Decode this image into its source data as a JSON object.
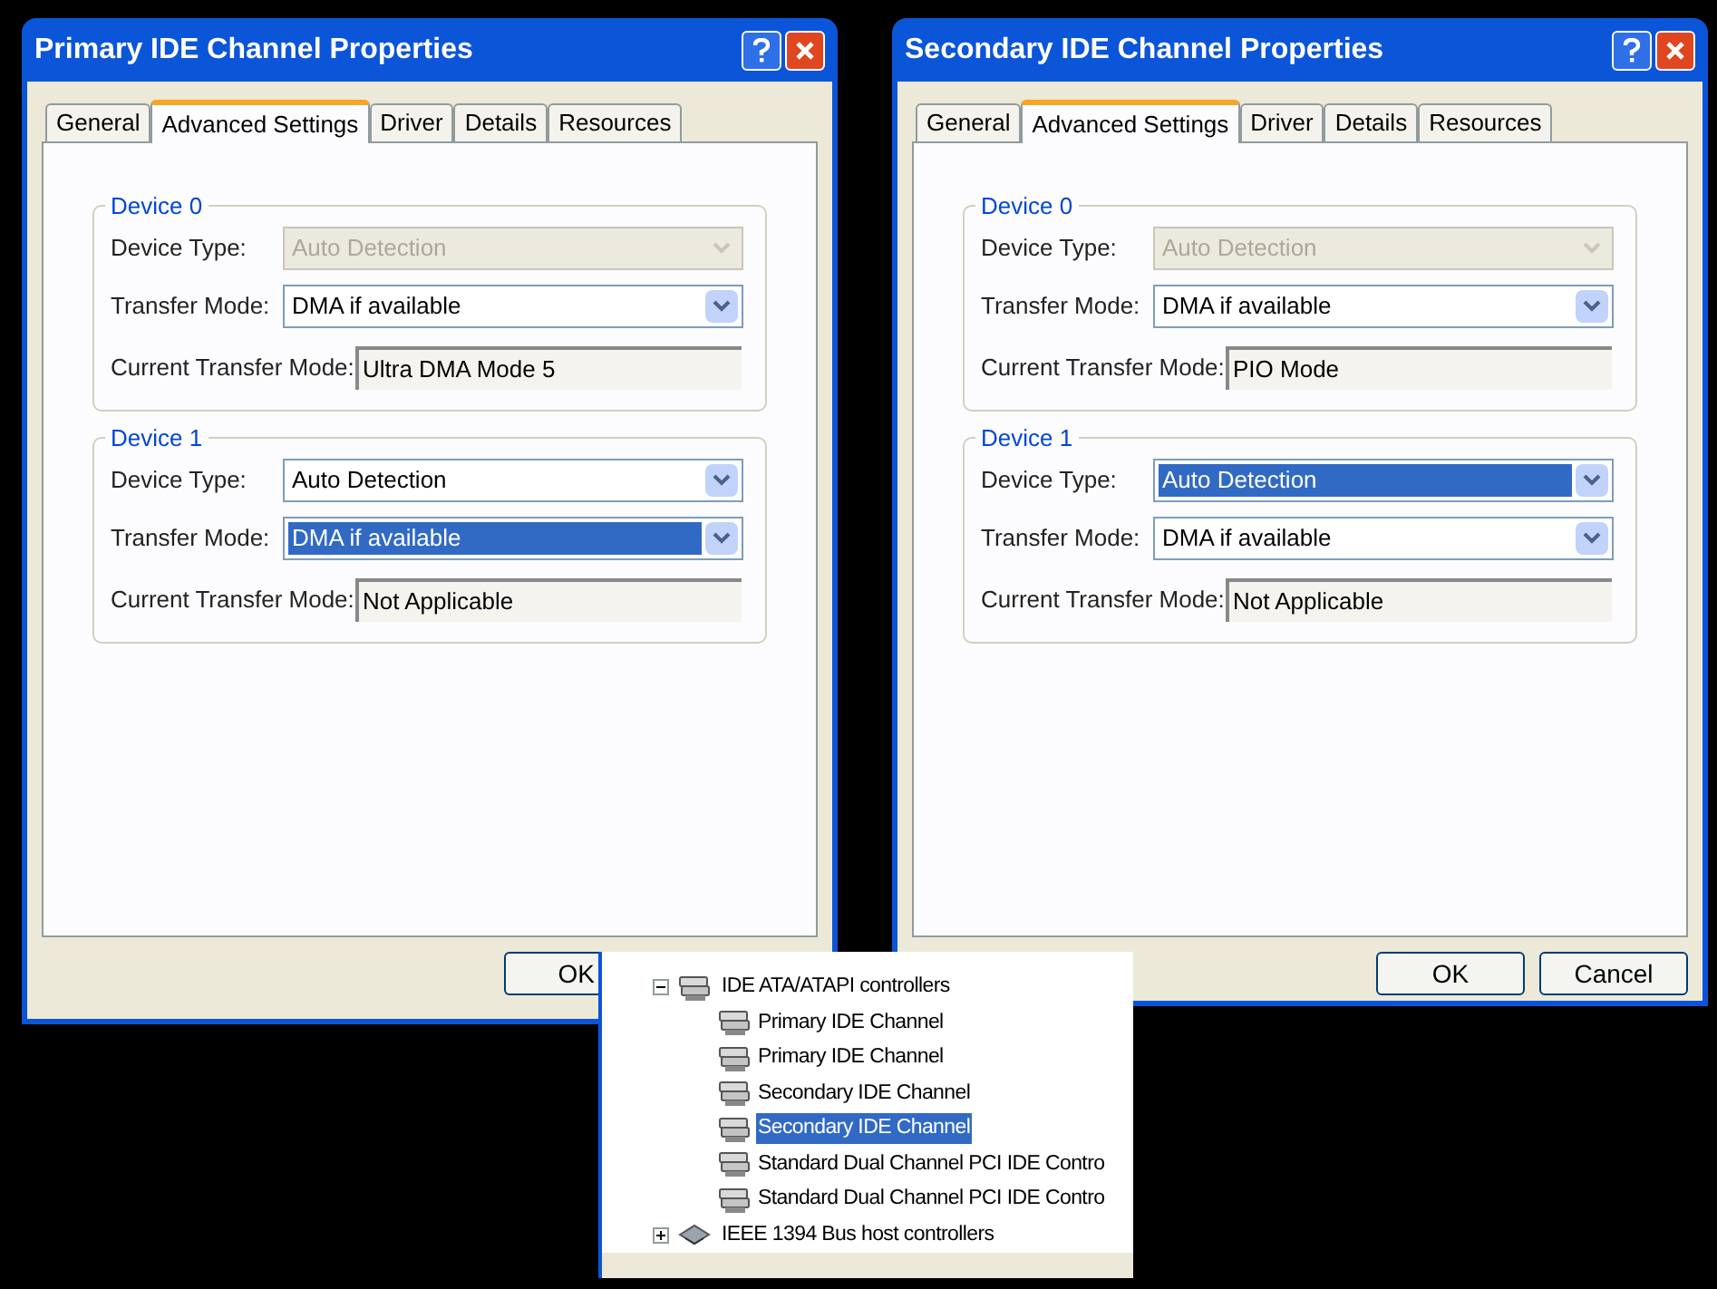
{
  "dialogs": [
    {
      "title": "Primary IDE Channel Properties",
      "tabs": [
        {
          "label": "General",
          "selected": false
        },
        {
          "label": "Advanced Settings",
          "selected": true
        },
        {
          "label": "Driver",
          "selected": false
        },
        {
          "label": "Details",
          "selected": false
        },
        {
          "label": "Resources",
          "selected": false
        }
      ],
      "groups": [
        {
          "title": "Device 0",
          "fields": [
            {
              "kind": "select",
              "label": "Device Type:",
              "value": "Auto Detection",
              "disabled": true,
              "selected": false
            },
            {
              "kind": "select",
              "label": "Transfer Mode:",
              "value": "DMA if available",
              "disabled": false,
              "selected": false
            },
            {
              "kind": "readonly",
              "label": "Current Transfer Mode:",
              "value": "Ultra DMA Mode 5"
            }
          ]
        },
        {
          "title": "Device 1",
          "fields": [
            {
              "kind": "select",
              "label": "Device Type:",
              "value": "Auto Detection",
              "disabled": false,
              "selected": false
            },
            {
              "kind": "select",
              "label": "Transfer Mode:",
              "value": "DMA if available",
              "disabled": false,
              "selected": true
            },
            {
              "kind": "readonly",
              "label": "Current Transfer Mode:",
              "value": "Not Applicable"
            }
          ]
        }
      ],
      "buttons": [
        "OK"
      ]
    },
    {
      "title": "Secondary IDE Channel Properties",
      "tabs": [
        {
          "label": "General",
          "selected": false
        },
        {
          "label": "Advanced Settings",
          "selected": true
        },
        {
          "label": "Driver",
          "selected": false
        },
        {
          "label": "Details",
          "selected": false
        },
        {
          "label": "Resources",
          "selected": false
        }
      ],
      "groups": [
        {
          "title": "Device 0",
          "fields": [
            {
              "kind": "select",
              "label": "Device Type:",
              "value": "Auto Detection",
              "disabled": true,
              "selected": false
            },
            {
              "kind": "select",
              "label": "Transfer Mode:",
              "value": "DMA if available",
              "disabled": false,
              "selected": false
            },
            {
              "kind": "readonly",
              "label": "Current Transfer Mode:",
              "value": "PIO Mode"
            }
          ]
        },
        {
          "title": "Device 1",
          "fields": [
            {
              "kind": "select",
              "label": "Device Type:",
              "value": "Auto Detection",
              "disabled": false,
              "selected": true
            },
            {
              "kind": "select",
              "label": "Transfer Mode:",
              "value": "DMA if available",
              "disabled": false,
              "selected": false
            },
            {
              "kind": "readonly",
              "label": "Current Transfer Mode:",
              "value": "Not Applicable"
            }
          ]
        }
      ],
      "buttons": [
        "OK",
        "Cancel"
      ]
    }
  ],
  "device_tree": {
    "items": [
      {
        "label": "IDE ATA/ATAPI controllers",
        "kind": "ide",
        "expanded": true,
        "children": [
          {
            "label": "Primary IDE Channel",
            "kind": "ide",
            "selected": false
          },
          {
            "label": "Primary IDE Channel",
            "kind": "ide",
            "selected": false
          },
          {
            "label": "Secondary IDE Channel",
            "kind": "ide",
            "selected": false
          },
          {
            "label": "Secondary IDE Channel",
            "kind": "ide",
            "selected": true
          },
          {
            "label": "Standard Dual Channel PCI IDE Contro",
            "kind": "ide",
            "selected": false
          },
          {
            "label": "Standard Dual Channel PCI IDE Contro",
            "kind": "ide",
            "selected": false
          }
        ]
      },
      {
        "label": "IEEE 1394 Bus host controllers",
        "kind": "bus",
        "expanded": false
      }
    ]
  }
}
